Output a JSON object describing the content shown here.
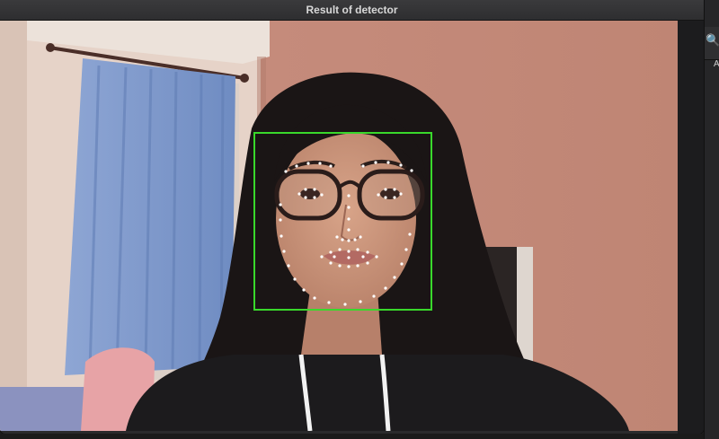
{
  "window": {
    "title": "Result of detector"
  },
  "side_panel": {
    "search_icon": "search-icon",
    "letter": "A"
  },
  "detector": {
    "box_color": "#39d82b",
    "landmark_color": "#ffffff"
  }
}
